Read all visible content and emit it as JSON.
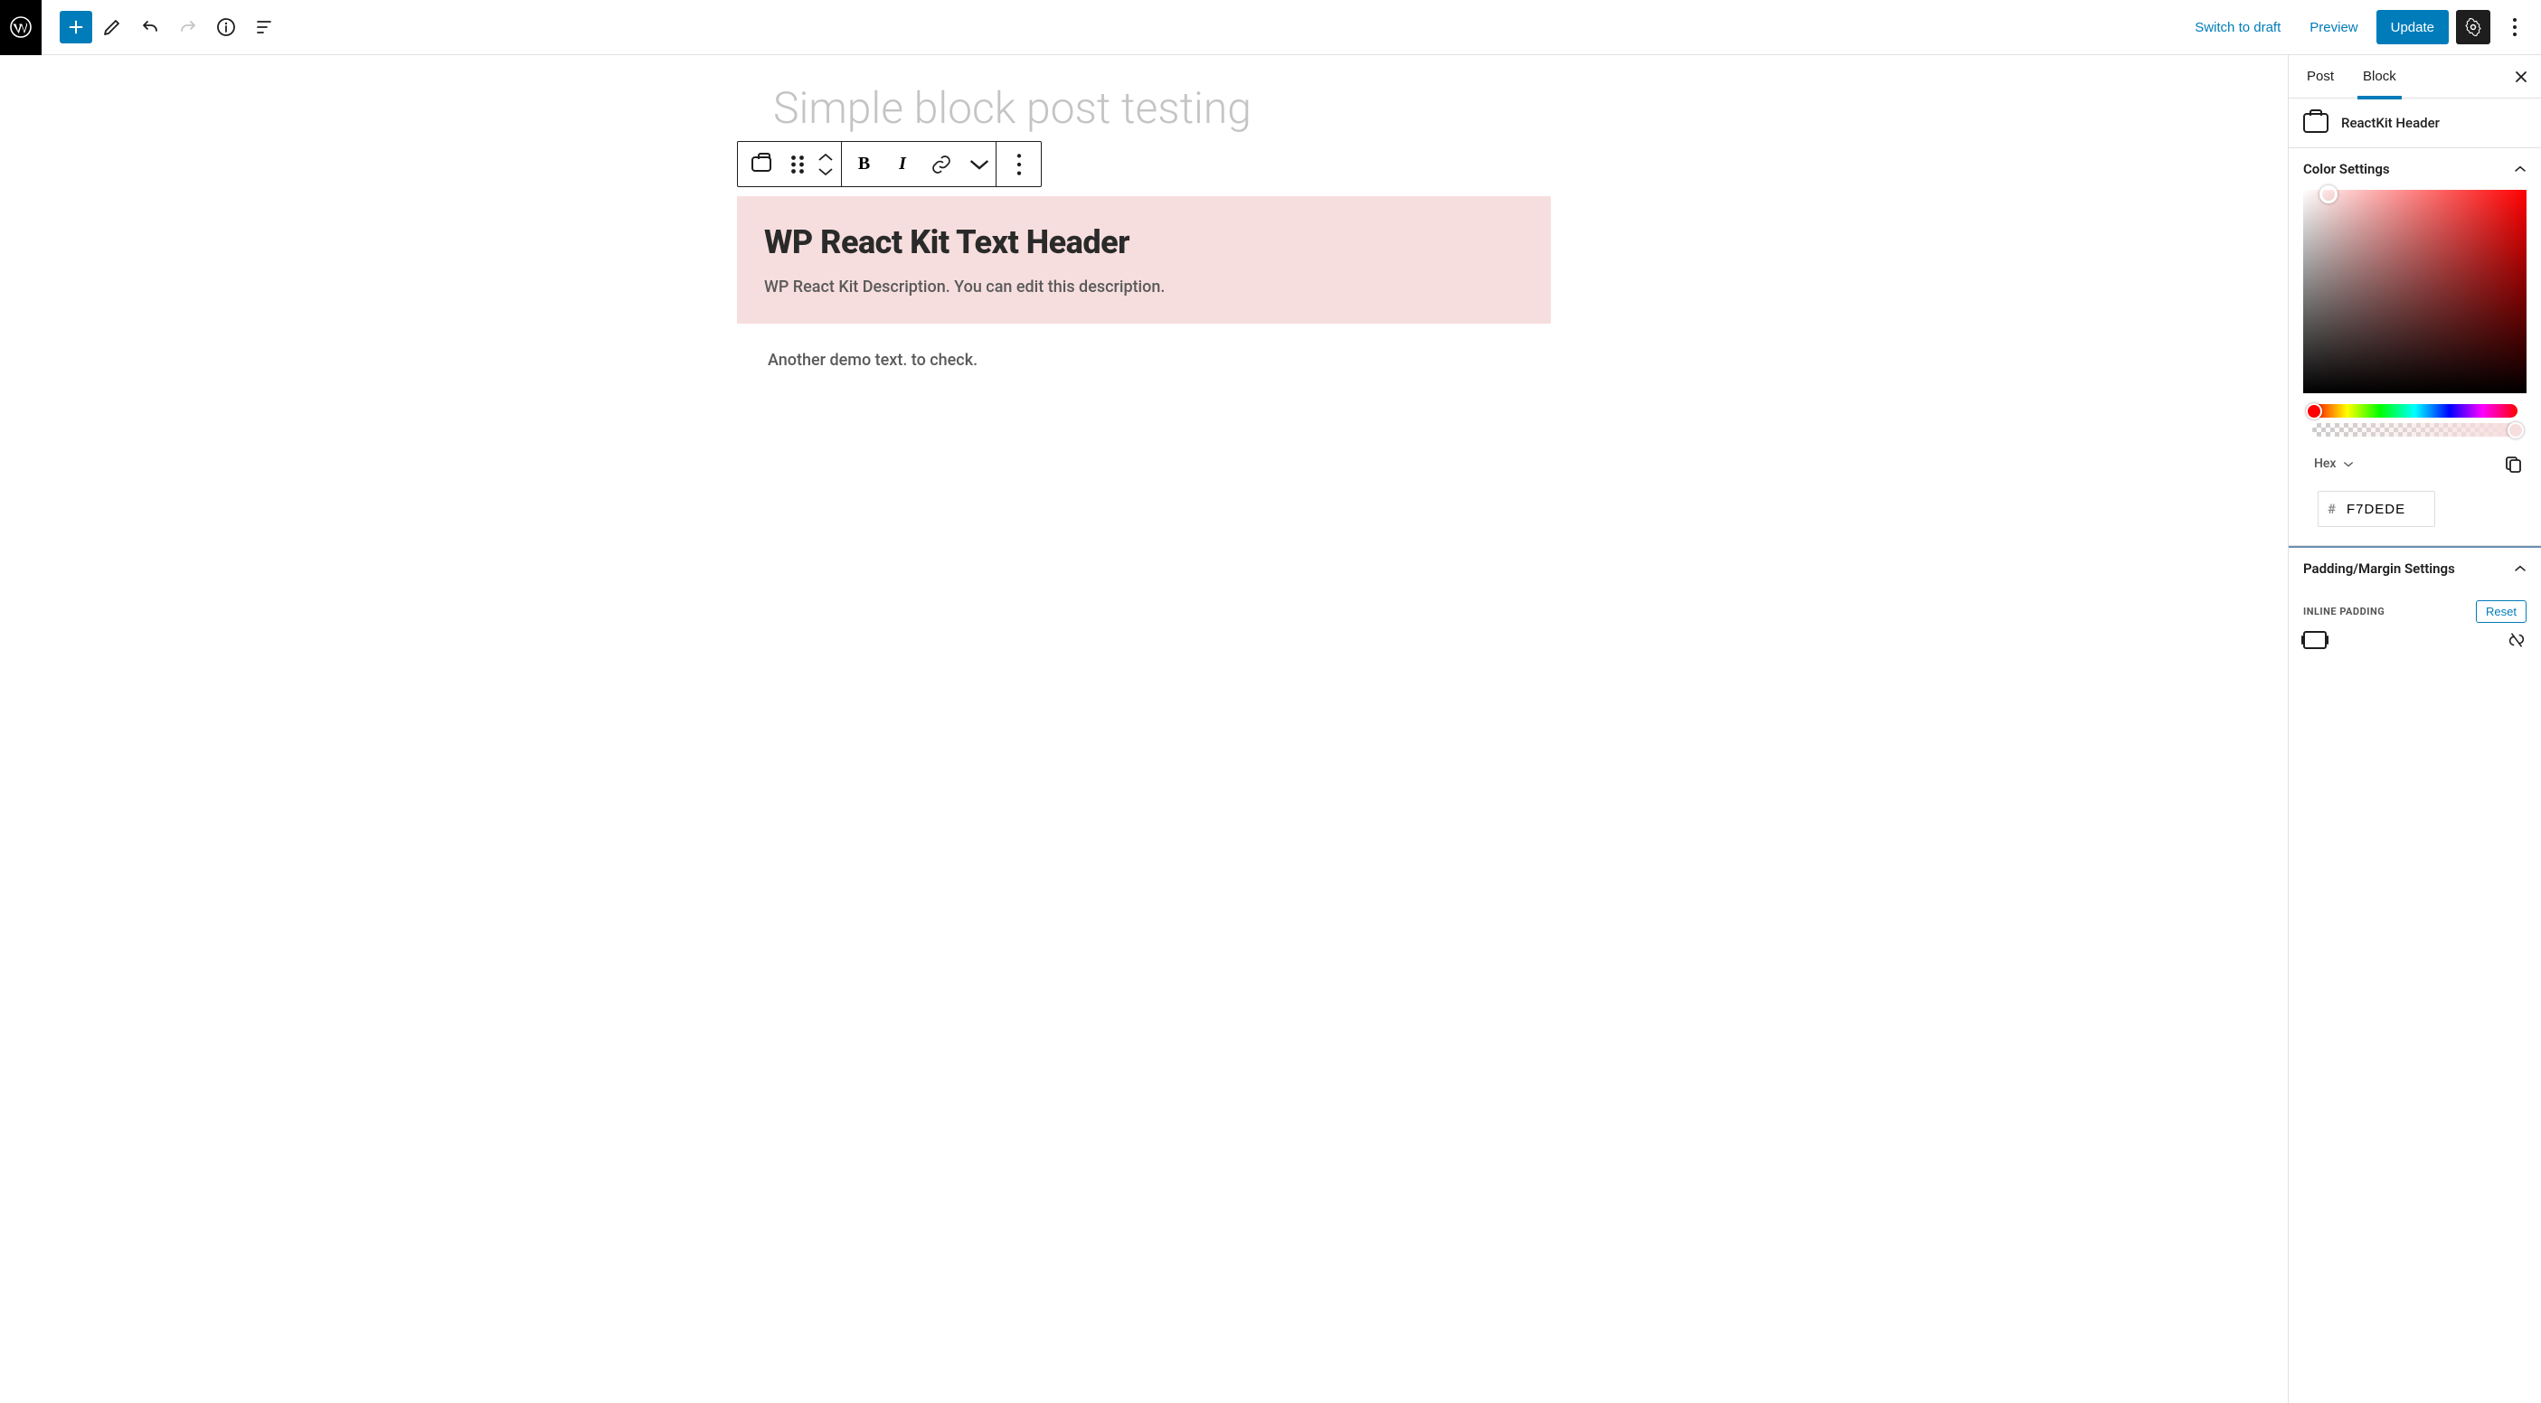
{
  "header": {
    "switch_to_draft": "Switch to draft",
    "preview": "Preview",
    "update": "Update"
  },
  "post_title_placeholder": "Simple block post testing",
  "reactkit_block": {
    "heading": "WP React Kit Text Header",
    "description": "WP React Kit Description. You can edit this description.",
    "bg_color": "#F7DEDE"
  },
  "demo_paragraph": "Another demo text. to check.",
  "sidebar": {
    "tabs": {
      "post": "Post",
      "block": "Block",
      "active": "block"
    },
    "block_name": "ReactKit Header",
    "panels": {
      "color": {
        "title": "Color Settings",
        "format_label": "Hex",
        "hex_prefix": "#",
        "hex_value": "F7DEDE"
      },
      "padding": {
        "title": "Padding/Margin Settings",
        "inline_label": "INLINE PADDING",
        "reset": "Reset"
      }
    }
  }
}
